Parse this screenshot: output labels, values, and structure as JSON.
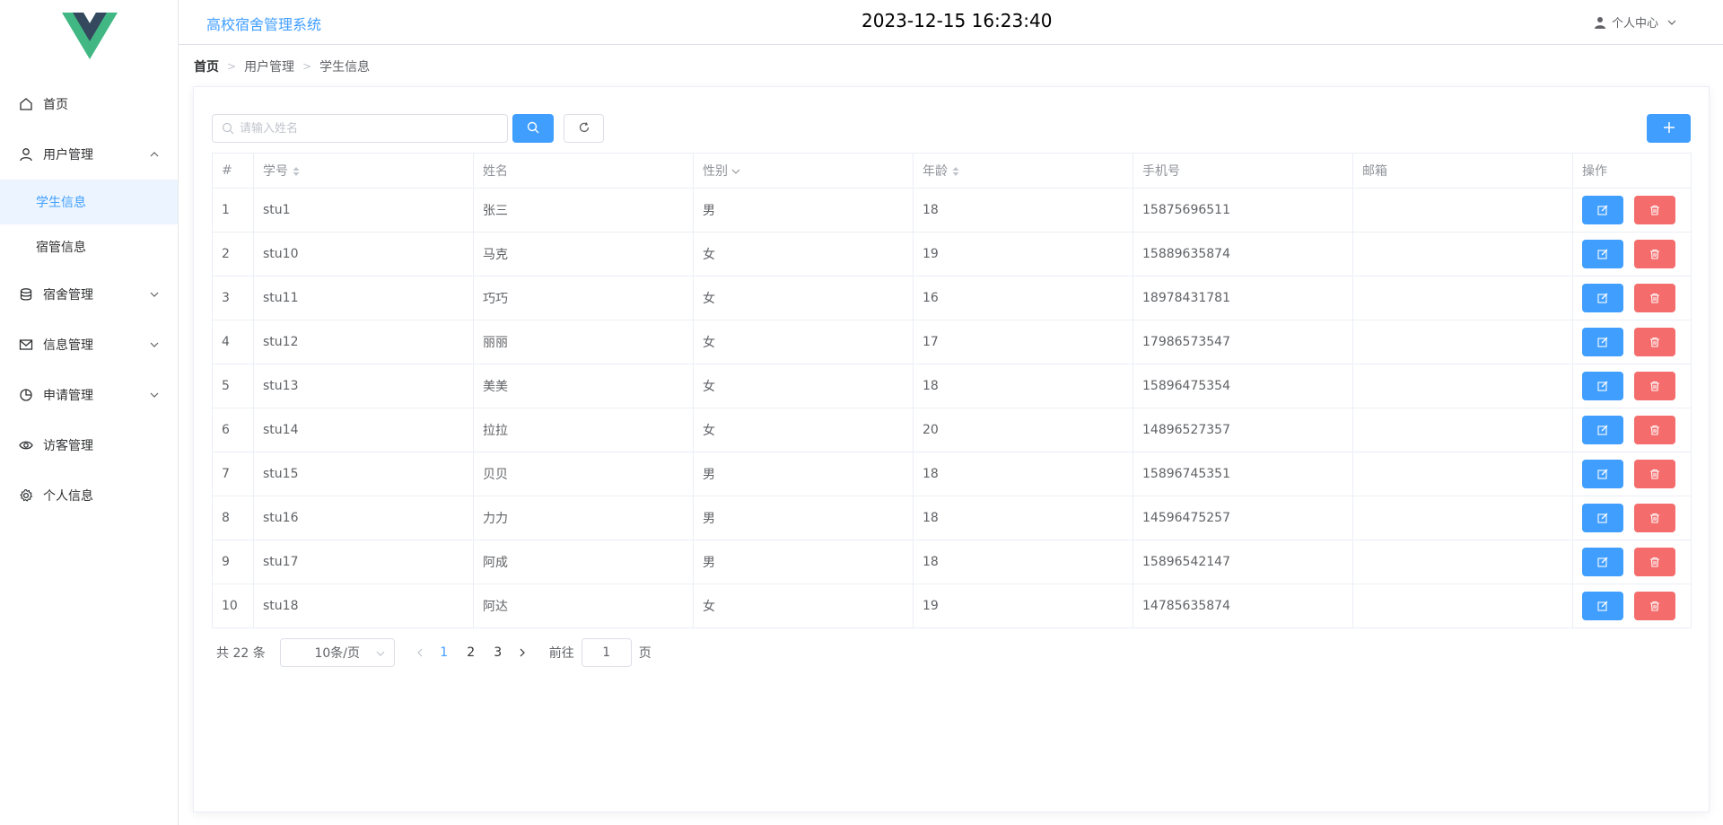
{
  "header": {
    "app_title": "高校宿舍管理系统",
    "clock": "2023-12-15 16:23:40",
    "user_menu_label": "个人中心"
  },
  "sidebar": {
    "items": [
      {
        "label": "首页",
        "icon": "home-icon"
      },
      {
        "label": "用户管理",
        "icon": "user-icon",
        "expanded": true,
        "children": [
          {
            "label": "学生信息",
            "active": true
          },
          {
            "label": "宿管信息"
          }
        ]
      },
      {
        "label": "宿舍管理",
        "icon": "database-icon"
      },
      {
        "label": "信息管理",
        "icon": "message-icon"
      },
      {
        "label": "申请管理",
        "icon": "pie-chart-icon"
      },
      {
        "label": "访客管理",
        "icon": "eye-icon"
      },
      {
        "label": "个人信息",
        "icon": "gear-icon"
      }
    ]
  },
  "breadcrumb": [
    "首页",
    "用户管理",
    "学生信息"
  ],
  "search": {
    "placeholder": "请输入姓名",
    "value": ""
  },
  "table": {
    "columns": [
      "#",
      "学号",
      "姓名",
      "性别",
      "年龄",
      "手机号",
      "邮箱",
      "操作"
    ],
    "rows": [
      [
        "1",
        "stu1",
        "张三",
        "男",
        "18",
        "15875696511",
        ""
      ],
      [
        "2",
        "stu10",
        "马克",
        "女",
        "19",
        "15889635874",
        ""
      ],
      [
        "3",
        "stu11",
        "巧巧",
        "女",
        "16",
        "18978431781",
        ""
      ],
      [
        "4",
        "stu12",
        "丽丽",
        "女",
        "17",
        "17986573547",
        ""
      ],
      [
        "5",
        "stu13",
        "美美",
        "女",
        "18",
        "15896475354",
        ""
      ],
      [
        "6",
        "stu14",
        "拉拉",
        "女",
        "20",
        "14896527357",
        ""
      ],
      [
        "7",
        "stu15",
        "贝贝",
        "男",
        "18",
        "15896745351",
        ""
      ],
      [
        "8",
        "stu16",
        "力力",
        "男",
        "18",
        "14596475257",
        ""
      ],
      [
        "9",
        "stu17",
        "阿成",
        "男",
        "18",
        "15896542147",
        ""
      ],
      [
        "10",
        "stu18",
        "阿达",
        "女",
        "19",
        "14785635874",
        ""
      ]
    ]
  },
  "pagination": {
    "total_text": "共 22 条",
    "page_size": "10条/页",
    "pages": [
      "1",
      "2",
      "3"
    ],
    "current": "1",
    "goto_label": "前往",
    "goto_value": "1",
    "goto_suffix": "页"
  },
  "colors": {
    "primary": "#409eff",
    "danger": "#f56c6c",
    "active_bg": "#ecf5ff"
  }
}
